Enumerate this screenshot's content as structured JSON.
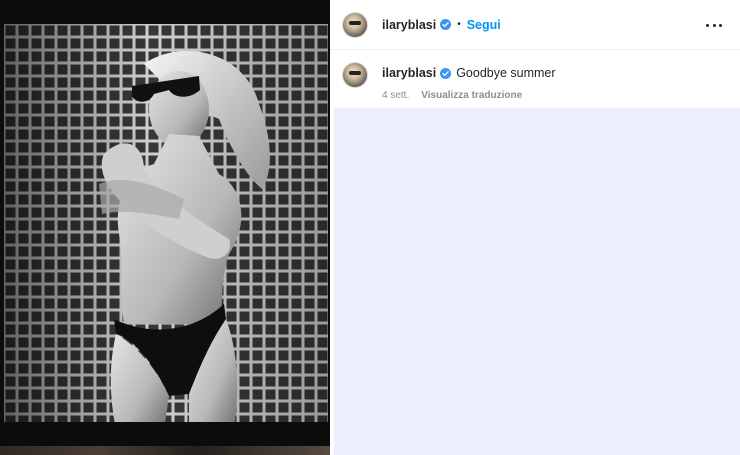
{
  "post": {
    "username": "ilaryblasi",
    "follow_label": "Segui",
    "separator": "•",
    "caption": "Goodbye summer",
    "time_ago": "4 sett.",
    "translate_label": "Visualizza traduzione"
  },
  "icons": {
    "verified": "verified-badge-icon",
    "more": "more-options-icon"
  },
  "colors": {
    "accent": "#0095f6",
    "text": "#262626",
    "muted": "#8e8e8e",
    "comments_bg": "#eceefc"
  }
}
